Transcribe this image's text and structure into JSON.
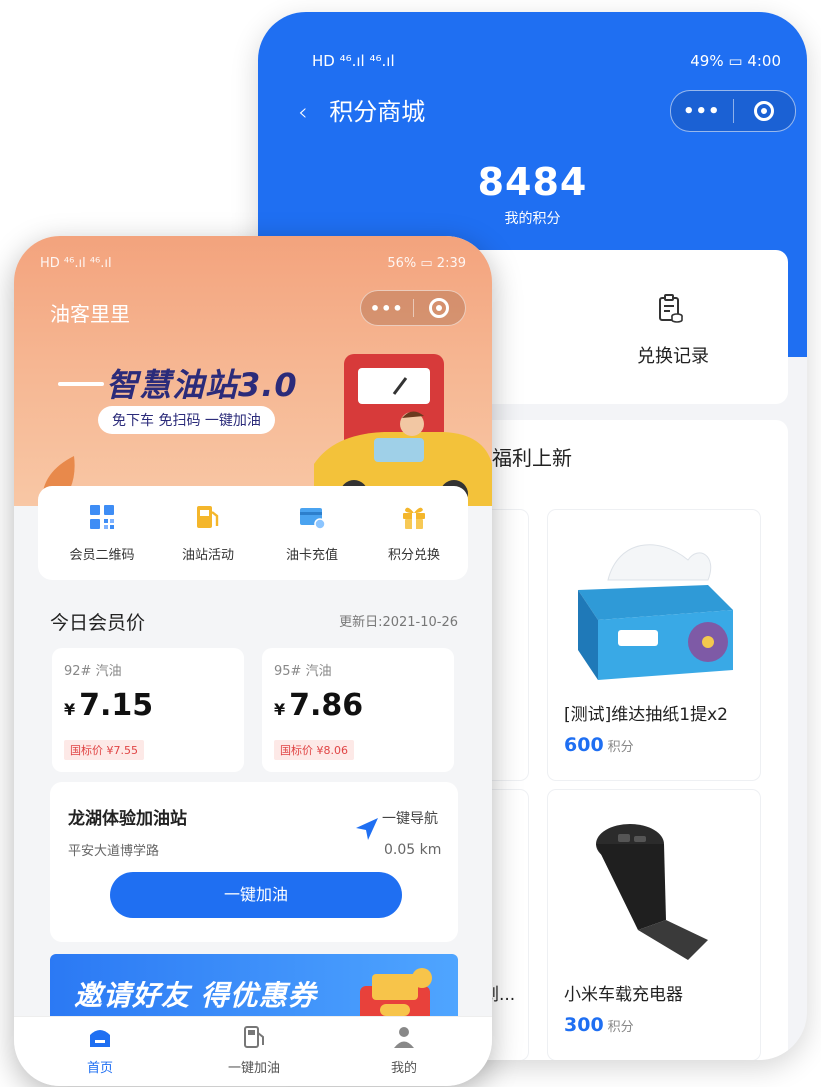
{
  "back_phone": {
    "status_bar": {
      "left": "HD ⁴⁶.ıl ⁴⁶.ıl",
      "right": "49% ▭ 4:00"
    },
    "nav": {
      "back_glyph": "‹",
      "title": "积分商城"
    },
    "capsule": {
      "more_glyph": "•••"
    },
    "points": {
      "value": "8484",
      "label": "我的积分"
    },
    "exchange_record": {
      "label": "兑换记录",
      "icon": "clipboard-icon"
    },
    "section_title": "福利上新",
    "products": [
      {
        "name": "[测试]维达抽纸1提x2",
        "points": "600",
        "unit": "积分"
      },
      {
        "name": "小米车载充电器",
        "points": "300",
        "unit": "积分"
      }
    ],
    "partial_product_text": "刨..."
  },
  "front_phone": {
    "status_bar": {
      "left": "HD ⁴⁶.ıl ⁴⁶.ıl",
      "right": "56% ▭ 2:39"
    },
    "app_title": "油客里里",
    "capsule": {
      "more_glyph": "•••"
    },
    "banner": {
      "slogan": "智慧油站3.0",
      "tagline": "免下车 免扫码 一键加油"
    },
    "quick_actions": [
      {
        "label": "会员二维码",
        "icon": "qrcode-icon",
        "color": "#3e8df5"
      },
      {
        "label": "油站活动",
        "icon": "fuel-pump-icon",
        "color": "#f4b62b"
      },
      {
        "label": "油卡充值",
        "icon": "card-icon",
        "color": "#4aa3f0"
      },
      {
        "label": "积分兑换",
        "icon": "gift-icon",
        "color": "#f4b62b"
      }
    ],
    "member_price": {
      "title": "今日会员价",
      "date_label": "更新日:2021-10-26",
      "items": [
        {
          "grade": "92# 汽油",
          "currency": "¥",
          "price": "7.15",
          "ref": "国标价 ¥7.55"
        },
        {
          "grade": "95# 汽油",
          "currency": "¥",
          "price": "7.86",
          "ref": "国标价 ¥8.06"
        }
      ]
    },
    "station": {
      "name": "龙湖体验加油站",
      "address": "平安大道博学路",
      "nav_label": "一键导航",
      "distance": "0.05 km",
      "refuel_label": "一键加油"
    },
    "invite": {
      "text": "邀请好友 得优惠券"
    },
    "tabbar": [
      {
        "label": "首页",
        "icon": "home-icon",
        "active": true
      },
      {
        "label": "一键加油",
        "icon": "gas-station-icon",
        "active": false
      },
      {
        "label": "我的",
        "icon": "user-icon",
        "active": false
      }
    ]
  },
  "colors": {
    "primary_blue": "#1f6ff2",
    "banner_orange": "#f6b793",
    "price_red": "#e04545"
  }
}
